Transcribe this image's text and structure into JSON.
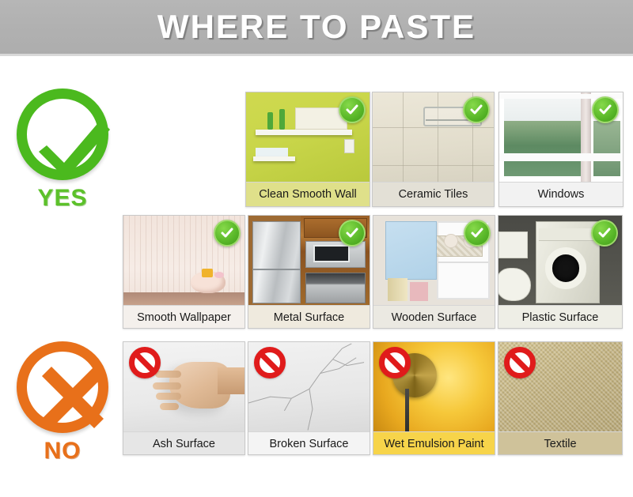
{
  "header": {
    "title": "WHERE TO PASTE"
  },
  "verdicts": {
    "yes": {
      "label": "YES",
      "icon": "check-circle-icon",
      "color": "#4bb91e"
    },
    "no": {
      "label": "NO",
      "icon": "cross-circle-icon",
      "color": "#e8701a"
    }
  },
  "badges": {
    "allowed": "green-check-badge-icon",
    "forbidden": "red-prohibition-badge-icon"
  },
  "rows": [
    {
      "type": "allowed",
      "cards": [
        {
          "label": "Clean Smooth Wall",
          "scene": "yellow-green-wall-with-white-shelves",
          "caption_bg": "#dfe08a"
        },
        {
          "label": "Ceramic Tiles",
          "scene": "cream-bathroom-tiles-with-towel-rack",
          "caption_bg": "#e3e0d6"
        },
        {
          "label": "Windows",
          "scene": "window-with-green-trees-outside",
          "caption_bg": "#f2f2f2"
        }
      ]
    },
    {
      "type": "allowed",
      "cards": [
        {
          "label": "Smooth Wallpaper",
          "scene": "cream-striped-wallpaper-with-pig-toy",
          "caption_bg": "#f4f0ec"
        },
        {
          "label": "Metal Surface",
          "scene": "steel-fridge-microwave-in-wood-kitchen",
          "caption_bg": "#efeade"
        },
        {
          "label": "Wooden Surface",
          "scene": "blue-cabinet-door-with-white-shelf-unit",
          "caption_bg": "#ebe9e2"
        },
        {
          "label": "Plastic Surface",
          "scene": "white-washing-machine-beside-toilet",
          "caption_bg": "#eeeee6"
        }
      ]
    },
    {
      "type": "forbidden",
      "cards": [
        {
          "label": "Ash Surface",
          "scene": "hand-touching-white-chalky-wall",
          "caption_bg": "#e6e6e6"
        },
        {
          "label": "Broken Surface",
          "scene": "cracked-white-wall",
          "caption_bg": "#f4f4f4"
        },
        {
          "label": "Wet Emulsion Paint",
          "scene": "golden-yellow-wet-painted-wall",
          "caption_bg": "#f7d44a"
        },
        {
          "label": "Textile",
          "scene": "khaki-woven-fabric",
          "caption_bg": "#cfc29a"
        }
      ]
    }
  ]
}
